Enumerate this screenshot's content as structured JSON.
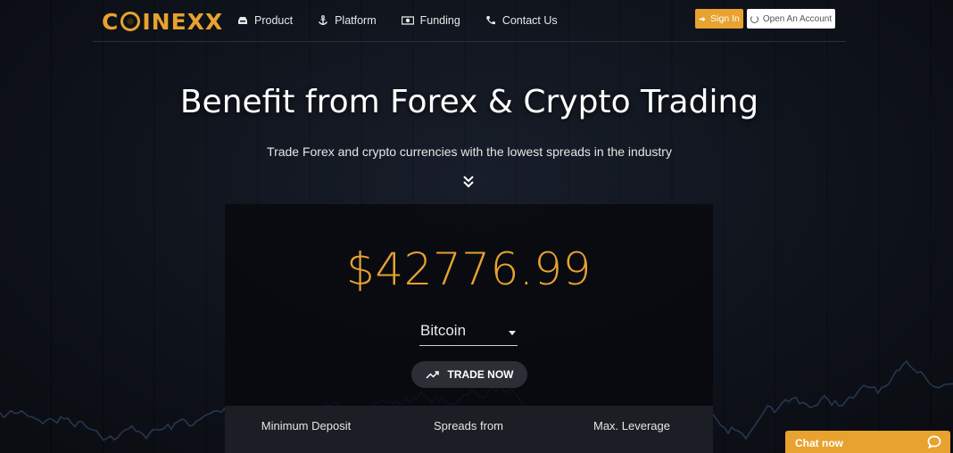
{
  "brand": {
    "logo_text_start": "C",
    "logo_text_end": "INEXX"
  },
  "nav": {
    "items": [
      {
        "label": "Product",
        "icon": "inbox-icon"
      },
      {
        "label": "Platform",
        "icon": "anchor-icon"
      },
      {
        "label": "Funding",
        "icon": "money-icon"
      },
      {
        "label": "Contact Us",
        "icon": "phone-icon"
      }
    ],
    "signin_label": "Sign In",
    "open_account_label": "Open An Account"
  },
  "hero": {
    "title": "Benefit from Forex & Crypto Trading",
    "subtitle": "Trade Forex and crypto currencies with the lowest spreads in the industry"
  },
  "ticker": {
    "price": "$42776.99",
    "selected_asset": "Bitcoin",
    "trade_label": "TRADE NOW"
  },
  "stats": {
    "min_deposit_label": "Minimum Deposit",
    "spreads_label": "Spreads from",
    "leverage_label": "Max. Leverage"
  },
  "chat": {
    "label": "Chat now"
  },
  "colors": {
    "accent": "#e8a22f",
    "background": "#0b0f17",
    "panel": "#07090e",
    "stats_bar": "#1b1e24"
  }
}
